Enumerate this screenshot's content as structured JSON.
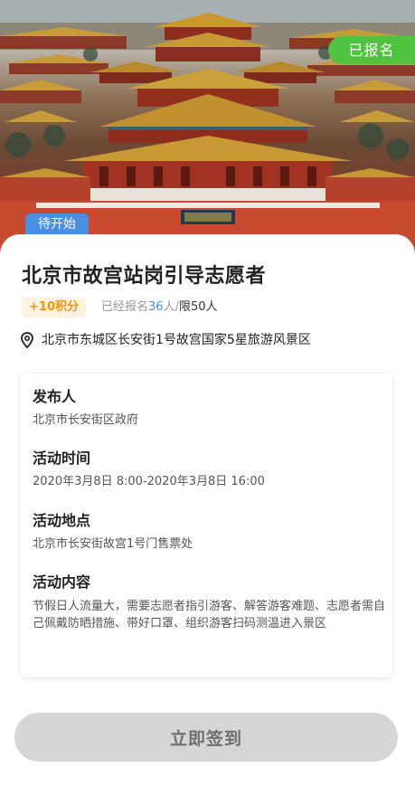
{
  "hero": {
    "status_badge": "已报名",
    "activity_state_badge": "待开始"
  },
  "activity": {
    "title": "北京市故宫站岗引导志愿者",
    "points": "+10积分",
    "registered_prefix": "已经报名",
    "registered_count": "36",
    "registered_unit": "人",
    "separator": "/",
    "limit": "限50人",
    "address": "北京市东城区长安街1号故宫国家5星旅游风景区"
  },
  "details": {
    "publisher_label": "发布人",
    "publisher_value": "北京市长安街区政府",
    "time_label": "活动时间",
    "time_value": "2020年3月8日 8:00-2020年3月8日 16:00",
    "location_label": "活动地点",
    "location_value": "北京市长安街故宫1号门售票处",
    "content_label": "活动内容",
    "content_value": "节假日人流量大，需要志愿者指引游客、解答游客难题、志愿者需自己佩戴防晒措施、带好口罩、组织游客扫码测温进入景区"
  },
  "actions": {
    "signin_label": "立即签到"
  },
  "colors": {
    "registered_badge": "#4fc23f",
    "upcoming_badge": "#4a90e2",
    "points_text": "#f0960f",
    "points_bg": "#fff3e0",
    "count_accent": "#4a90e2",
    "button_bg": "#d6d6d6"
  },
  "icons": {
    "address": "location-pin-icon"
  }
}
